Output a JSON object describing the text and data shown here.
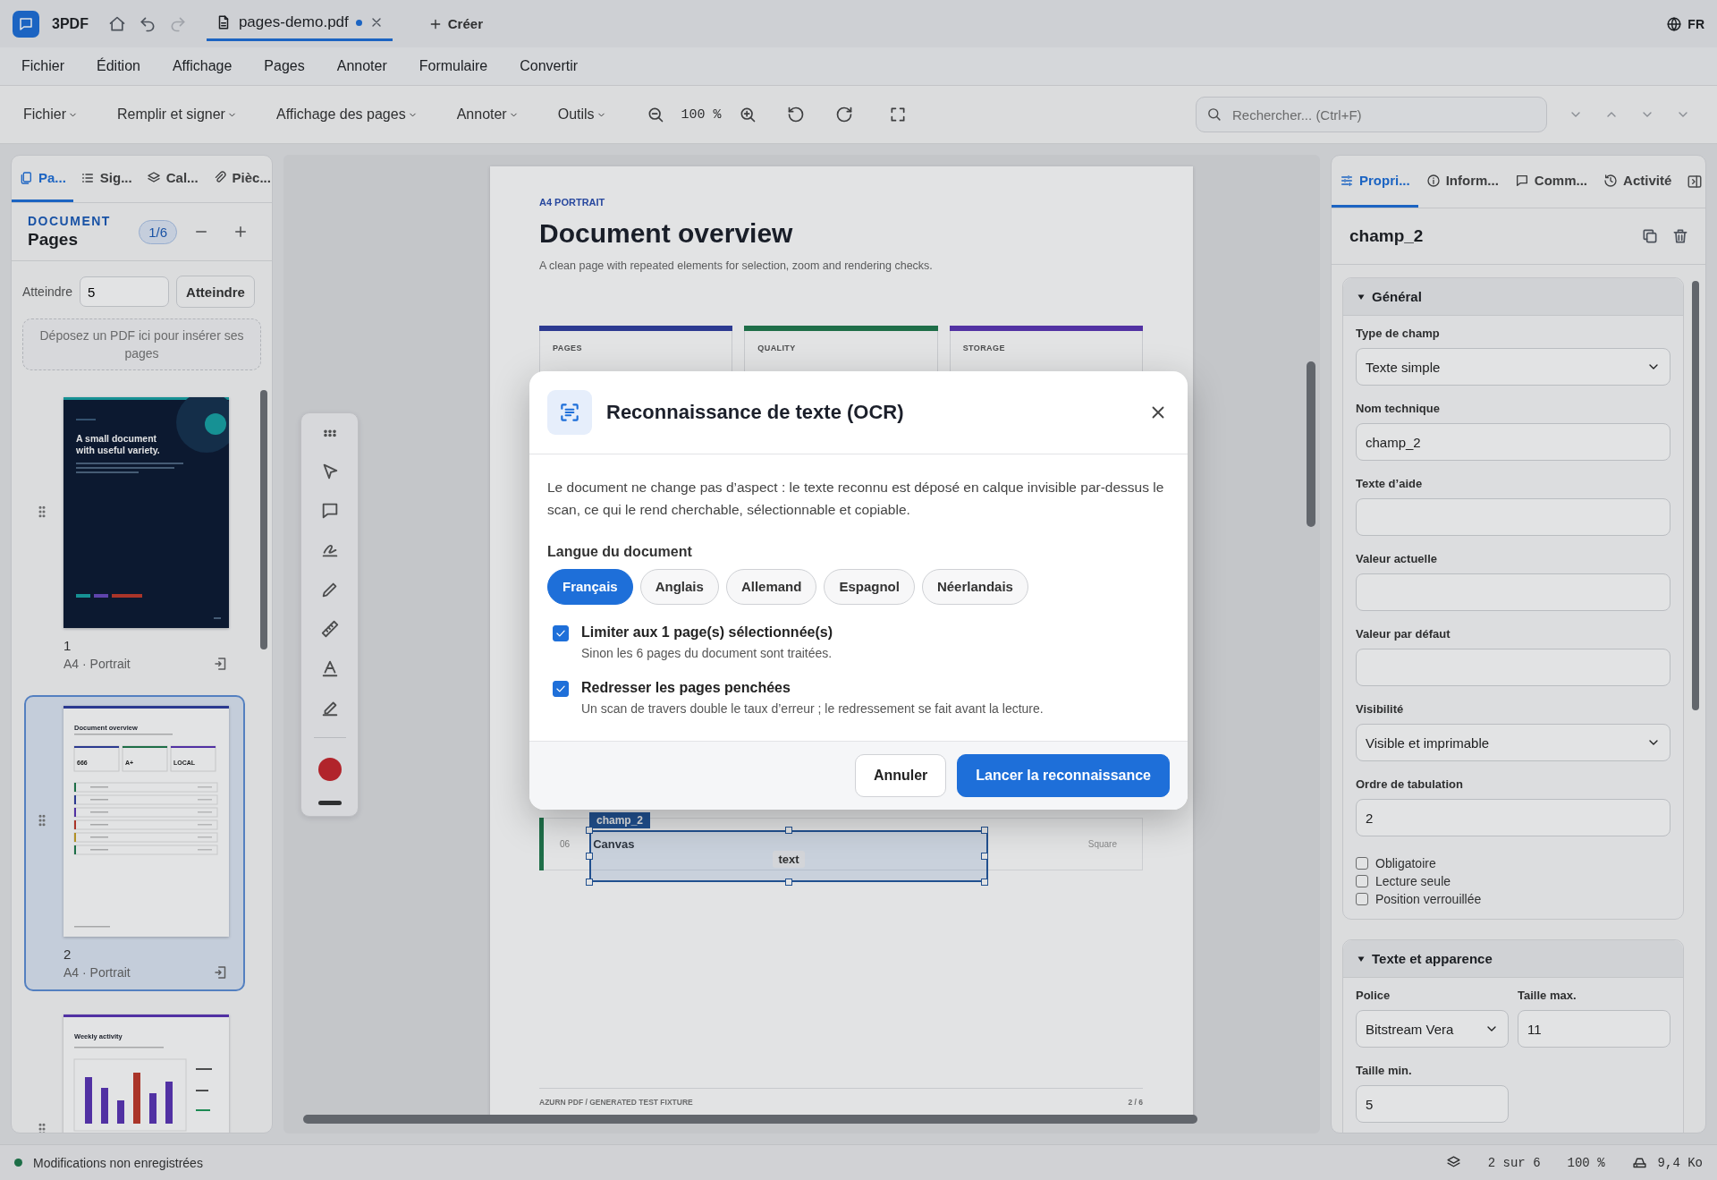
{
  "app": {
    "name": "3PDF"
  },
  "titlebar": {
    "tabs": [
      {
        "label": "pages-demo.pdf",
        "selected": true,
        "unsaved": true
      }
    ],
    "new_tab": "Créer",
    "language": "FR"
  },
  "menu": [
    "Fichier",
    "Édition",
    "Affichage",
    "Pages",
    "Annoter",
    "Formulaire",
    "Convertir"
  ],
  "toolbar": {
    "menus": [
      "Fichier",
      "Remplir et signer",
      "Affichage des pages",
      "Annoter",
      "Outils"
    ],
    "zoom": "100 %",
    "search": {
      "placeholder": "Rechercher... (Ctrl+F)"
    }
  },
  "left_panel": {
    "tabs": [
      {
        "label": "Pa...",
        "kind": "pages",
        "selected": true
      },
      {
        "label": "Sig...",
        "kind": "list",
        "selected": false
      },
      {
        "label": "Cal...",
        "kind": "layers",
        "selected": false
      },
      {
        "label": "Pièc...",
        "kind": "attachment",
        "selected": false
      }
    ],
    "eyebrow": "DOCUMENT",
    "title": "Pages",
    "page_badge": "1/6",
    "goto": {
      "label": "Atteindre",
      "value": "5",
      "button": "Atteindre"
    },
    "dropzone": "Déposez un PDF ici pour insérer ses pages",
    "thumbnails": [
      {
        "kind": "cover",
        "number": "1",
        "format": "A4 · Portrait",
        "selected": false,
        "title": "A small document with useful variety."
      },
      {
        "kind": "overview",
        "number": "2",
        "format": "A4 · Portrait",
        "selected": true,
        "title": "Document overview",
        "stats": [
          "666",
          "A+",
          "LOCAL"
        ]
      },
      {
        "kind": "chart",
        "selected": false,
        "title": "Weekly activity"
      }
    ]
  },
  "document": {
    "eyebrow": "A4 PORTRAIT",
    "title": "Document overview",
    "subtitle": "A clean page with repeated elements for selection, zoom and rendering checks.",
    "cards": [
      {
        "label": "PAGES",
        "color": "#2c3a91"
      },
      {
        "label": "QUALITY",
        "color": "#1e6e48"
      },
      {
        "label": "STORAGE",
        "color": "#5232a3"
      }
    ],
    "row": {
      "number": "06",
      "name": "Canvas",
      "type": "Square",
      "color": "#1e6e48"
    },
    "field": {
      "name": "champ_2",
      "value": "text",
      "selected": true
    },
    "footer": "AZURN PDF / GENERATED TEST FIXTURE",
    "page": "2 / 6"
  },
  "right_panel": {
    "tabs": [
      {
        "label": "Propri...",
        "kind": "sliders",
        "selected": true
      },
      {
        "label": "Inform...",
        "kind": "info",
        "selected": false
      },
      {
        "label": "Comm...",
        "kind": "comment",
        "selected": false
      },
      {
        "label": "Activité",
        "kind": "history",
        "selected": false
      }
    ],
    "title": "champ_2",
    "sections": [
      {
        "title": "Général",
        "expanded": true,
        "fields": [
          {
            "kind": "select",
            "label": "Type de champ",
            "value": "Texte simple"
          },
          {
            "kind": "input",
            "label": "Nom technique",
            "value": "champ_2"
          },
          {
            "kind": "input",
            "label": "Texte d’aide"
          },
          {
            "kind": "input",
            "label": "Valeur actuelle"
          },
          {
            "kind": "input",
            "label": "Valeur par défaut"
          },
          {
            "kind": "select",
            "label": "Visibilité",
            "value": "Visible et imprimable"
          },
          {
            "kind": "input",
            "label": "Ordre de tabulation",
            "value": "2"
          }
        ],
        "checkboxes": [
          {
            "label": "Obligatoire",
            "checked": false
          },
          {
            "label": "Lecture seule",
            "checked": false
          },
          {
            "label": "Position verrouillée",
            "checked": false
          }
        ]
      },
      {
        "title": "Texte et apparence",
        "expanded": true,
        "fields": [
          {
            "kind": "select",
            "label": "Police",
            "value": "Bitstream Vera"
          },
          {
            "kind": "input",
            "label": "Taille max.",
            "value": "11"
          },
          {
            "kind": "input",
            "label": "Taille min.",
            "value": "5"
          }
        ]
      }
    ]
  },
  "status_bar": {
    "message": "Modifications non enregistrées",
    "page": "2 sur 6",
    "zoom": "100 %",
    "size": "9,4 Ko"
  },
  "dialog": {
    "title": "Reconnaissance de texte (OCR)",
    "description": "Le document ne change pas d’aspect : le texte reconnu est déposé en calque invisible par-dessus le scan, ce qui le rend cherchable, sélectionnable et copiable.",
    "language_label": "Langue du document",
    "languages": [
      {
        "label": "Français",
        "selected": true
      },
      {
        "label": "Anglais",
        "selected": false
      },
      {
        "label": "Allemand",
        "selected": false
      },
      {
        "label": "Espagnol",
        "selected": false
      },
      {
        "label": "Néerlandais",
        "selected": false
      }
    ],
    "options": [
      {
        "label": "Limiter aux 1 page(s) sélectionnée(s)",
        "hint": "Sinon les 6 pages du document sont traitées.",
        "checked": true
      },
      {
        "label": "Redresser les pages penchées",
        "hint": "Un scan de travers double le taux d’erreur ; le redressement se fait avant la lecture.",
        "checked": true
      }
    ],
    "buttons": [
      {
        "label": "Annuler",
        "kind": "secondary"
      },
      {
        "label": "Lancer la reconnaissance",
        "kind": "primary"
      }
    ]
  }
}
